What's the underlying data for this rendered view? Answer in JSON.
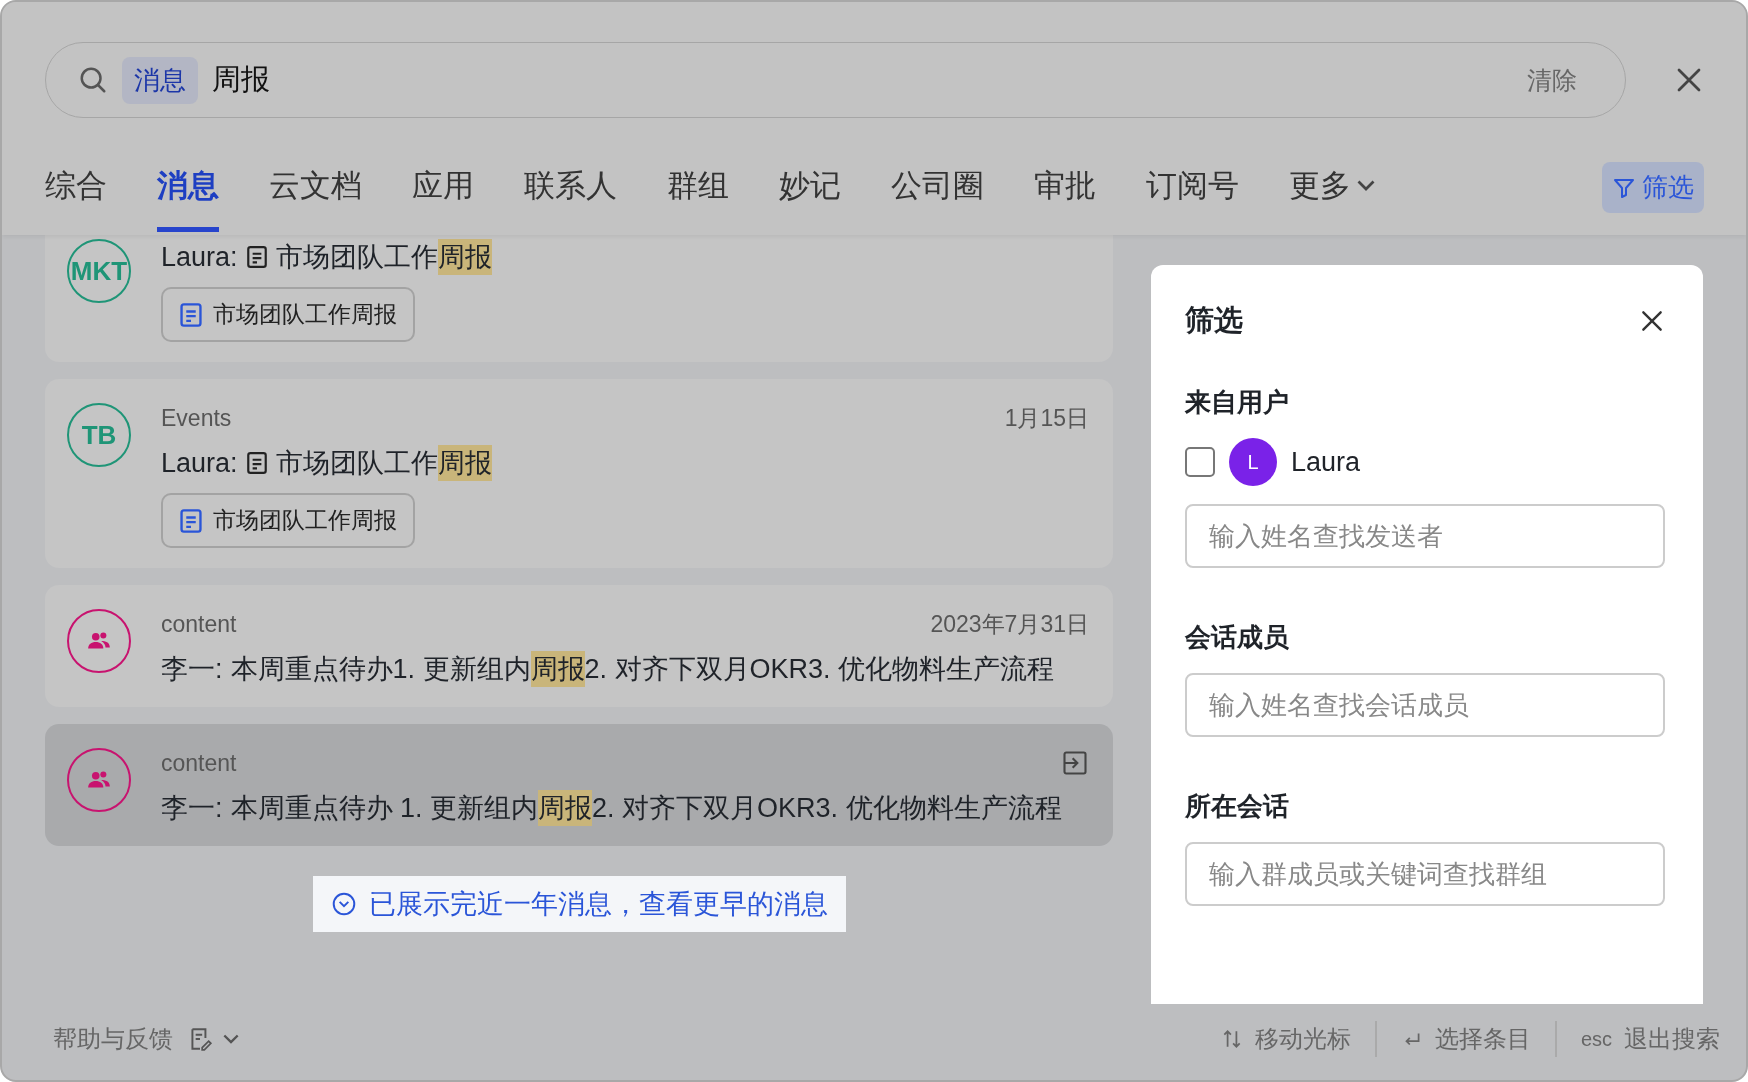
{
  "search": {
    "scope_tag": "消息",
    "query": "周报",
    "clear": "清除"
  },
  "tabs": [
    {
      "label": "综合",
      "selected": false,
      "kind": "plain"
    },
    {
      "label": "消息",
      "selected": true,
      "kind": "plain"
    },
    {
      "label": "云文档",
      "selected": false,
      "kind": "plain"
    },
    {
      "label": "应用",
      "selected": false,
      "kind": "plain"
    },
    {
      "label": "联系人",
      "selected": false,
      "kind": "plain"
    },
    {
      "label": "群组",
      "selected": false,
      "kind": "plain"
    },
    {
      "label": "妙记",
      "selected": false,
      "kind": "plain"
    },
    {
      "label": "公司圈",
      "selected": false,
      "kind": "plain"
    },
    {
      "label": "审批",
      "selected": false,
      "kind": "plain"
    },
    {
      "label": "订阅号",
      "selected": false,
      "kind": "plain"
    },
    {
      "label": "更多",
      "selected": false,
      "kind": "dropdown"
    }
  ],
  "filter_button": "筛选",
  "messages": [
    {
      "avatar_text": "MKT",
      "color": "#1f9577",
      "kind": "doc",
      "author": "Laura:",
      "segments": [
        {
          "text": "市场团队工作",
          "highlight": false
        },
        {
          "text": "周报",
          "highlight": true
        }
      ],
      "attachment": "市场团队工作周报",
      "selected": false
    },
    {
      "avatar_text": "TB",
      "color": "#1f9577",
      "chat": "Events",
      "date": "1月15日",
      "kind": "doc",
      "author": "Laura:",
      "segments": [
        {
          "text": "市场团队工作",
          "highlight": false
        },
        {
          "text": "周报",
          "highlight": true
        }
      ],
      "attachment": "市场团队工作周报",
      "selected": false
    },
    {
      "color": "#c8136f",
      "chat": "content",
      "date": "2023年7月31日",
      "kind": "text",
      "author": "李一:",
      "segments": [
        {
          "text": "本周重点待办1. 更新组内",
          "highlight": false
        },
        {
          "text": "周报",
          "highlight": true
        },
        {
          "text": "2. 对齐下双月OKR3. 优化物料生产流程",
          "highlight": false
        }
      ],
      "selected": false
    },
    {
      "color": "#c8136f",
      "chat": "content",
      "kind": "text",
      "author": "李一:",
      "segments": [
        {
          "text": "本周重点待办 1. 更新组内",
          "highlight": false
        },
        {
          "text": "周报",
          "highlight": true
        },
        {
          "text": "2. 对齐下双月OKR3. 优化物料生产流程",
          "highlight": false
        }
      ],
      "selected": true
    }
  ],
  "load_more": "已展示完近一年消息，查看更早的消息",
  "filter_panel": {
    "title": "筛选",
    "sections": [
      {
        "title": "来自用户",
        "users": [
          {
            "initial": "L",
            "name": "Laura",
            "checked": false
          }
        ],
        "placeholder": "输入姓名查找发送者"
      },
      {
        "title": "会话成员",
        "placeholder": "输入姓名查找会话成员"
      },
      {
        "title": "所在会话",
        "placeholder": "输入群成员或关键词查找群组"
      }
    ]
  },
  "footer": {
    "help": "帮助与反馈",
    "hints": [
      {
        "kind": "updown",
        "label": "移动光标"
      },
      {
        "kind": "enter",
        "label": "选择条目"
      },
      {
        "kind": "key",
        "key": "esc",
        "label": "退出搜索"
      }
    ]
  }
}
